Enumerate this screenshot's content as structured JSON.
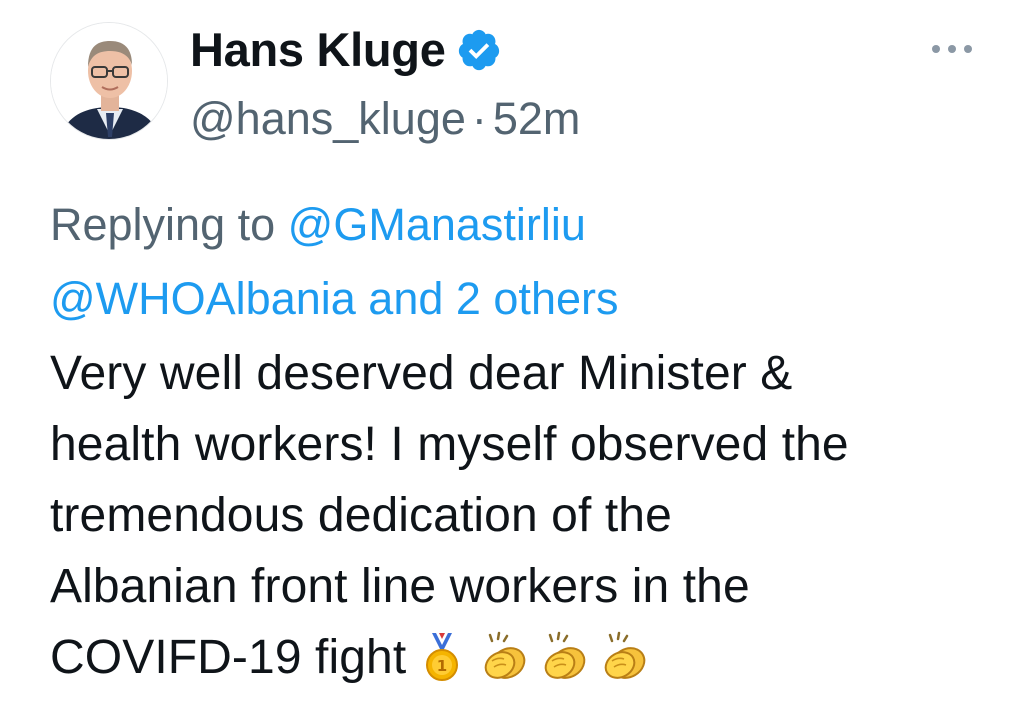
{
  "author": {
    "display_name": "Hans Kluge",
    "handle": "@hans_kluge",
    "separator": "·",
    "time_ago": "52m",
    "avatar_icon": "profile-photo",
    "verified_icon": "verified-badge-icon",
    "verified_color": "#1d9bf0"
  },
  "menu": {
    "more_icon": "more-options-icon"
  },
  "reply": {
    "prefix": "Replying to",
    "mention_1": "@GManastirliu",
    "mention_2": "@WHOAlbania",
    "others": "and 2 others"
  },
  "tweet": {
    "line_1": "Very well deserved dear Minister &",
    "line_2": "health workers! I myself observed the",
    "line_3": "tremendous dedication of the",
    "line_4": "Albanian front line workers in the",
    "line_5": "COVIFD-19 fight",
    "emojis": [
      "medal-icon",
      "clapping-hands-icon",
      "clapping-hands-icon",
      "clapping-hands-icon"
    ]
  },
  "colors": {
    "text": "#0f1419",
    "secondary": "#536471",
    "link": "#1d9bf0"
  }
}
